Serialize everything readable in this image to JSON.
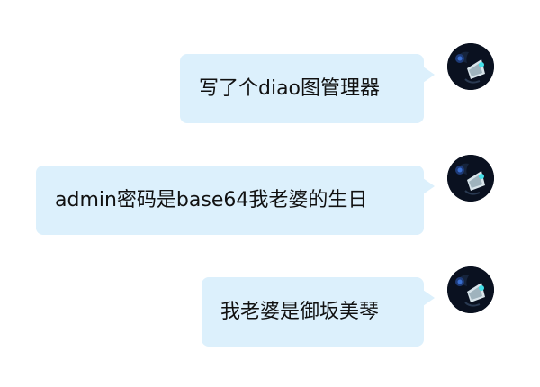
{
  "messages": [
    {
      "text": "写了个diao图管理器"
    },
    {
      "text": "admin密码是base64我老婆的生日"
    },
    {
      "text": "我老婆是御坂美琴"
    }
  ],
  "avatar": {
    "icon": "anime-character-avatar-icon"
  },
  "colors": {
    "bubble": "#dcf0fc",
    "text": "#111111",
    "background": "#ffffff"
  }
}
